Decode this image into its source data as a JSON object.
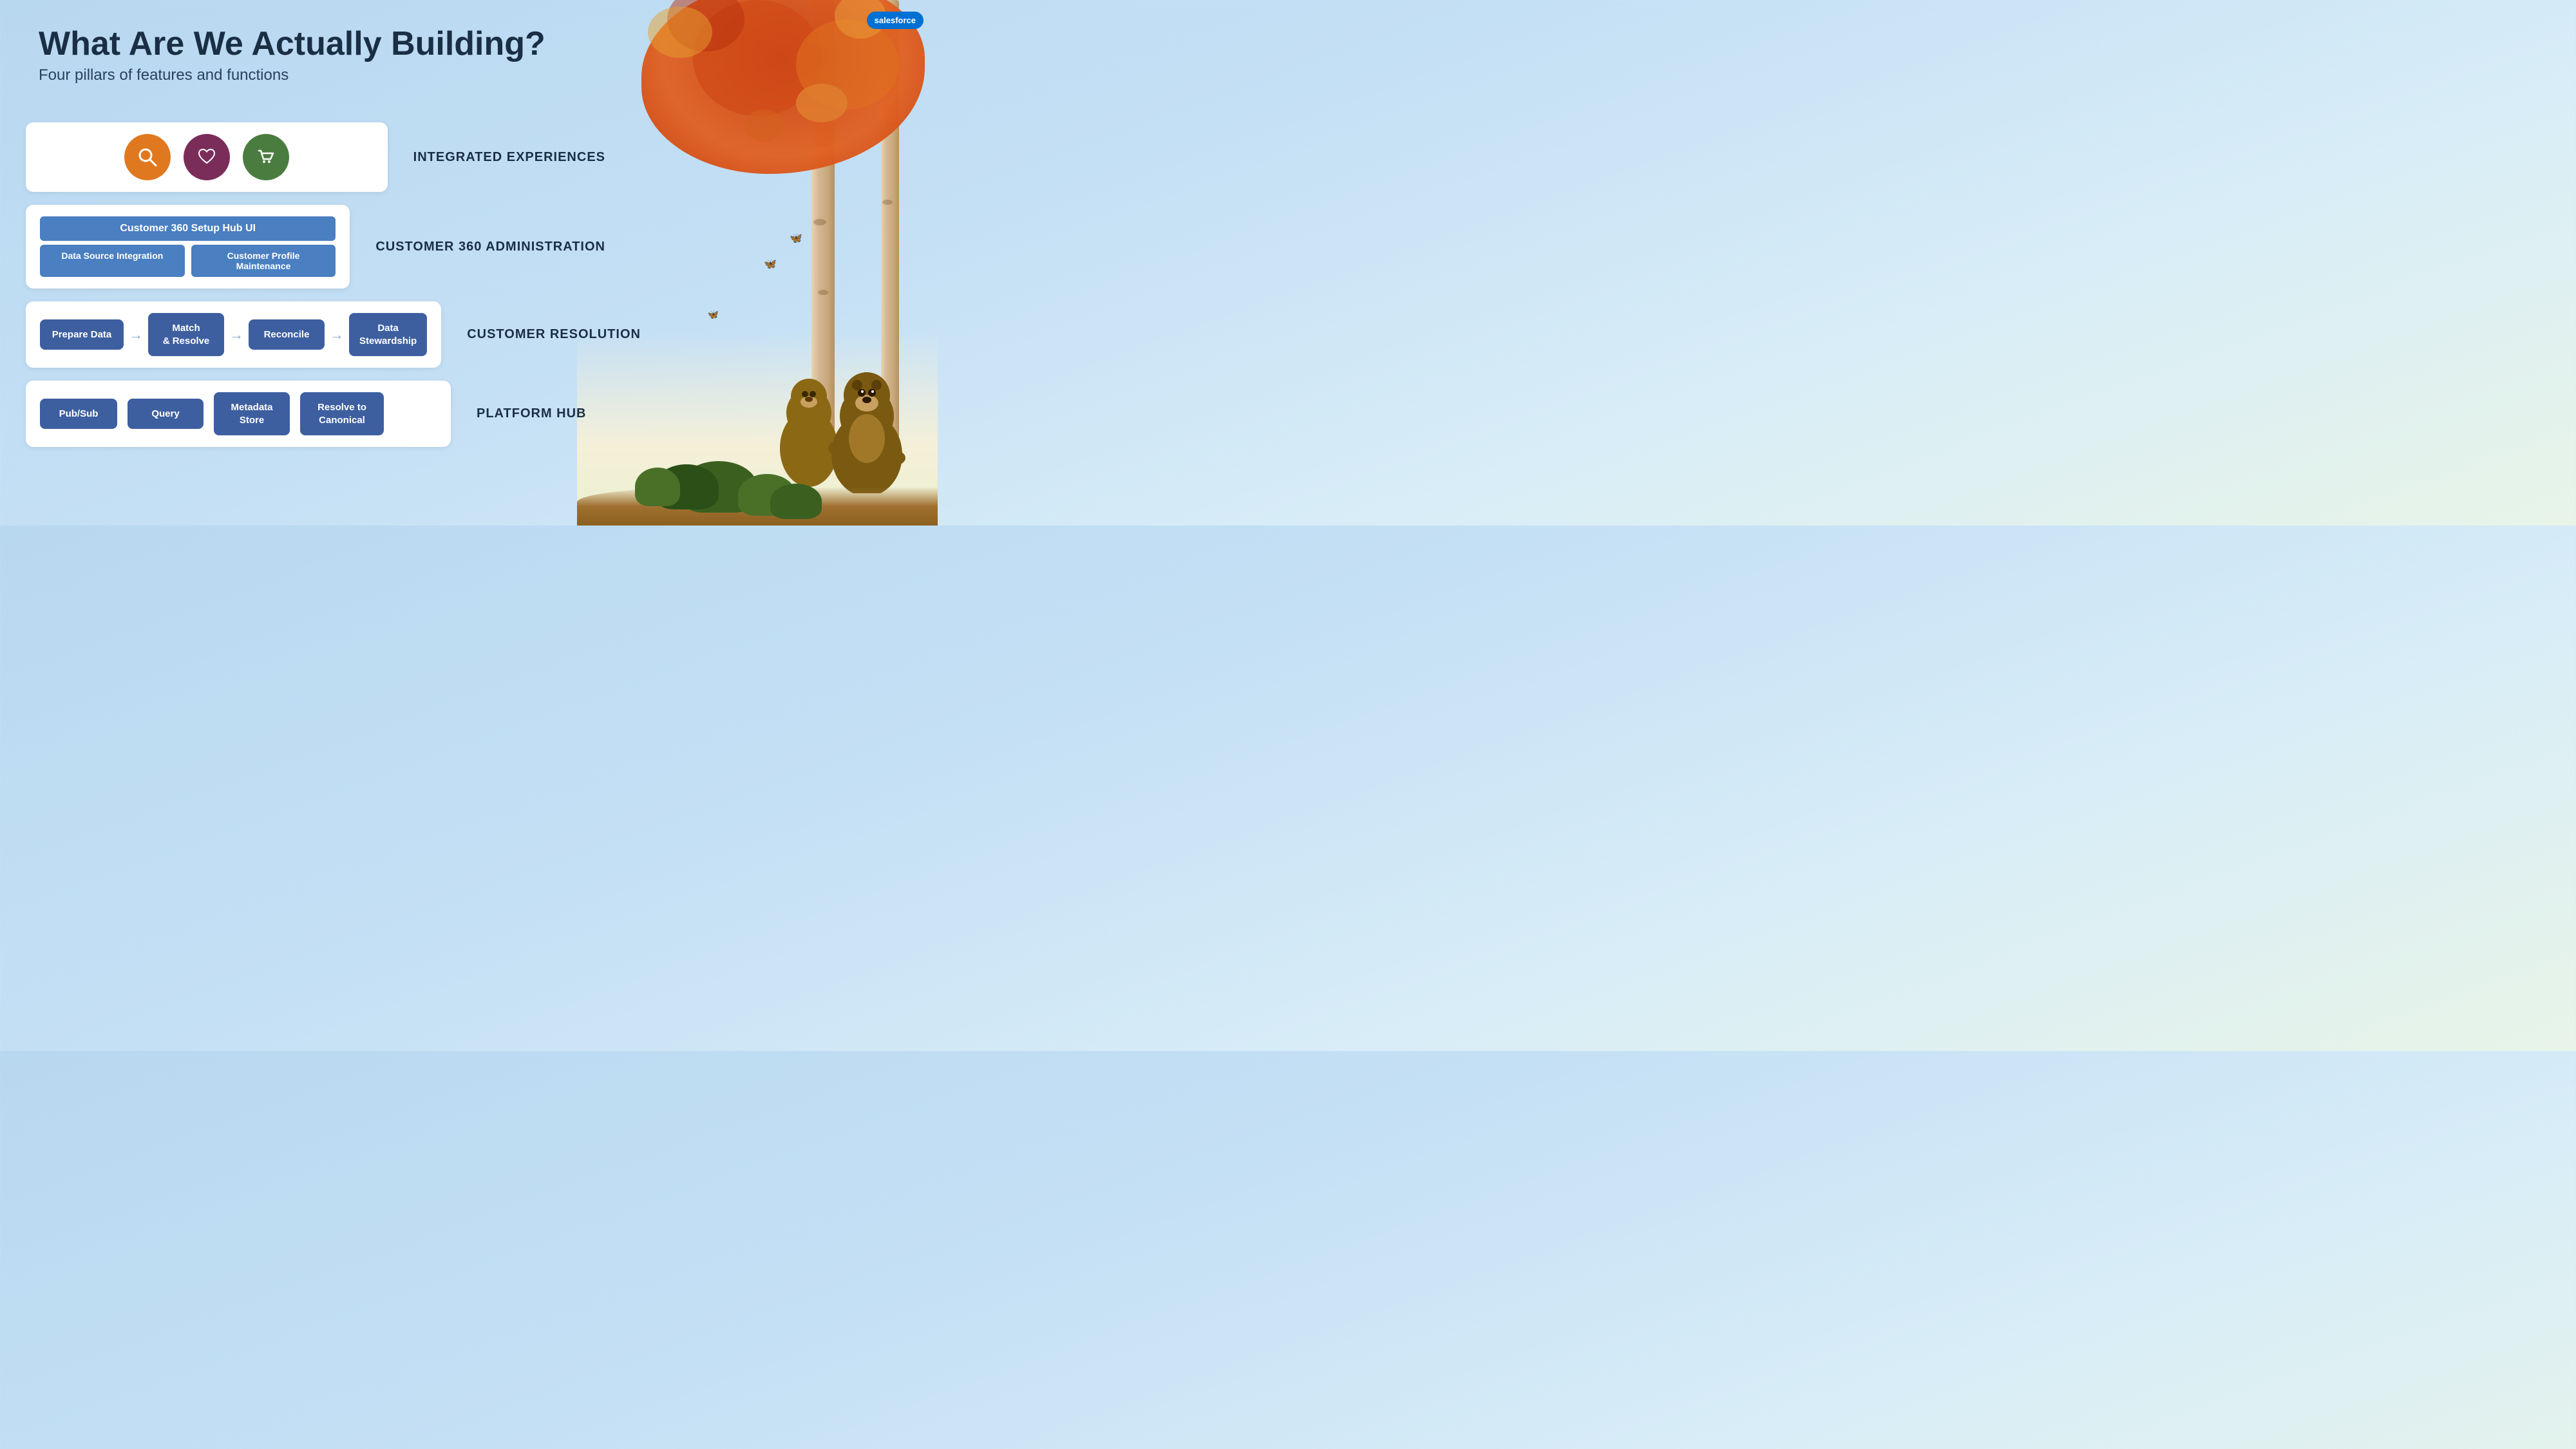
{
  "logo": {
    "text": "salesforce"
  },
  "header": {
    "title": "What Are We Actually Building?",
    "subtitle": "Four pillars of features and functions"
  },
  "pillars": [
    {
      "id": "integrated-experiences",
      "label": "INTEGRATED EXPERIENCES",
      "type": "icons",
      "icons": [
        {
          "name": "search-icon",
          "symbol": "🔍",
          "color": "orange"
        },
        {
          "name": "heart-icon",
          "symbol": "♡",
          "color": "burgundy"
        },
        {
          "name": "cart-icon",
          "symbol": "🛒",
          "color": "green-dark"
        }
      ]
    },
    {
      "id": "customer-360-admin",
      "label": "CUSTOMER 360 ADMINISTRATION",
      "type": "admin",
      "top_btn": "Customer 360 Setup Hub UI",
      "bottom_btns": [
        "Data Source Integration",
        "Customer Profile Maintenance"
      ]
    },
    {
      "id": "customer-resolution",
      "label": "CUSTOMER RESOLUTION",
      "type": "boxes",
      "boxes": [
        "Prepare Data",
        "Match\n& Resolve",
        "Reconcile",
        "Data\nStewardship"
      ]
    },
    {
      "id": "platform-hub",
      "label": "PLATFORM HUB",
      "type": "boxes",
      "boxes": [
        "Pub/Sub",
        "Query",
        "Metadata\nStore",
        "Resolve to\nCanonical"
      ]
    }
  ]
}
